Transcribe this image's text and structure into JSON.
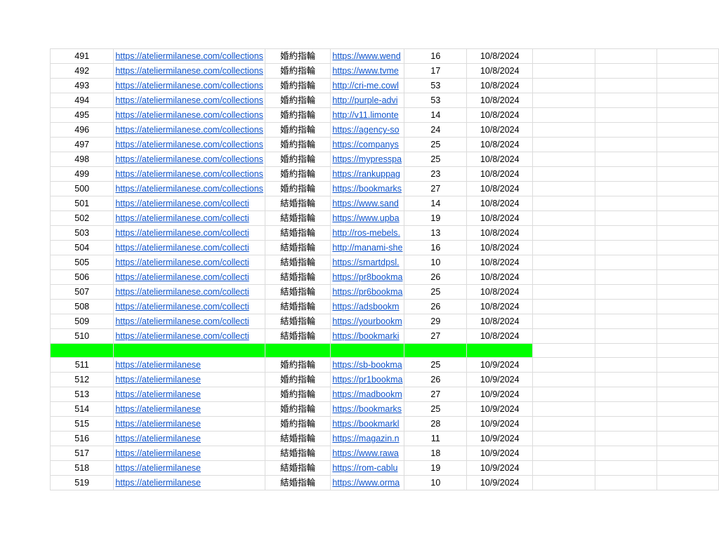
{
  "colors": {
    "separator_fill": "#00ff00",
    "link": "#1155cc",
    "grid": "#dcdcdc"
  },
  "rows": [
    {
      "num": "491",
      "url": "https://ateliermilanese.com/collections",
      "kw": "婚約指輪",
      "link": "https://www.wend",
      "count": "16",
      "date": "10/8/2024"
    },
    {
      "num": "492",
      "url": "https://ateliermilanese.com/collections",
      "kw": "婚約指輪",
      "link": "https://www.tvme",
      "count": "17",
      "date": "10/8/2024"
    },
    {
      "num": "493",
      "url": "https://ateliermilanese.com/collections",
      "kw": "婚約指輪",
      "link": "http://cri-me.cowl",
      "count": "53",
      "date": "10/8/2024"
    },
    {
      "num": "494",
      "url": "https://ateliermilanese.com/collections",
      "kw": "婚約指輪",
      "link": "http://purple-advi",
      "count": "53",
      "date": "10/8/2024"
    },
    {
      "num": "495",
      "url": "https://ateliermilanese.com/collections",
      "kw": "婚約指輪",
      "link": "http://v11.limonte",
      "count": "14",
      "date": "10/8/2024"
    },
    {
      "num": "496",
      "url": "https://ateliermilanese.com/collections",
      "kw": "婚約指輪",
      "link": "https://agency-so",
      "count": "24",
      "date": "10/8/2024"
    },
    {
      "num": "497",
      "url": "https://ateliermilanese.com/collections",
      "kw": "婚約指輪",
      "link": "https://companys",
      "count": "25",
      "date": "10/8/2024"
    },
    {
      "num": "498",
      "url": "https://ateliermilanese.com/collections",
      "kw": "婚約指輪",
      "link": "https://mypresspa",
      "count": "25",
      "date": "10/8/2024"
    },
    {
      "num": "499",
      "url": "https://ateliermilanese.com/collections",
      "kw": "婚約指輪",
      "link": "https://rankuppag",
      "count": "23",
      "date": "10/8/2024"
    },
    {
      "num": "500",
      "url": "https://ateliermilanese.com/collections",
      "kw": "婚約指輪",
      "link": "https://bookmarks",
      "count": "27",
      "date": "10/8/2024"
    },
    {
      "num": "501",
      "url": "https://ateliermilanese.com/collecti",
      "kw": "結婚指輪",
      "link": "https://www.sand",
      "count": "14",
      "date": "10/8/2024"
    },
    {
      "num": "502",
      "url": "https://ateliermilanese.com/collecti",
      "kw": "結婚指輪",
      "link": "https://www.upba",
      "count": "19",
      "date": "10/8/2024"
    },
    {
      "num": "503",
      "url": "https://ateliermilanese.com/collecti",
      "kw": "結婚指輪",
      "link": "http://ros-mebels.",
      "count": "13",
      "date": "10/8/2024"
    },
    {
      "num": "504",
      "url": "https://ateliermilanese.com/collecti",
      "kw": "結婚指輪",
      "link": "http://manami-she",
      "count": "16",
      "date": "10/8/2024"
    },
    {
      "num": "505",
      "url": "https://ateliermilanese.com/collecti",
      "kw": "結婚指輪",
      "link": "https://smartdpsl.",
      "count": "10",
      "date": "10/8/2024"
    },
    {
      "num": "506",
      "url": "https://ateliermilanese.com/collecti",
      "kw": "結婚指輪",
      "link": "https://pr8bookma",
      "count": "26",
      "date": "10/8/2024"
    },
    {
      "num": "507",
      "url": "https://ateliermilanese.com/collecti",
      "kw": "結婚指輪",
      "link": "https://pr6bookma",
      "count": "25",
      "date": "10/8/2024"
    },
    {
      "num": "508",
      "url": "https://ateliermilanese.com/collecti",
      "kw": "結婚指輪",
      "link": "https://adsbookm",
      "count": "26",
      "date": "10/8/2024"
    },
    {
      "num": "509",
      "url": "https://ateliermilanese.com/collecti",
      "kw": "結婚指輪",
      "link": "https://yourbookm",
      "count": "29",
      "date": "10/8/2024"
    },
    {
      "num": "510",
      "url": "https://ateliermilanese.com/collecti",
      "kw": "結婚指輪",
      "link": "https://bookmarki",
      "count": "27",
      "date": "10/8/2024"
    },
    {
      "separator": true
    },
    {
      "num": "511",
      "url": "https://ateliermilanese",
      "kw": "婚約指輪",
      "link": "https://sb-bookma",
      "count": "25",
      "date": "10/9/2024"
    },
    {
      "num": "512",
      "url": "https://ateliermilanese",
      "kw": "婚約指輪",
      "link": "https://pr1bookma",
      "count": "26",
      "date": "10/9/2024"
    },
    {
      "num": "513",
      "url": "https://ateliermilanese",
      "kw": "婚約指輪",
      "link": "https://madbookm",
      "count": "27",
      "date": "10/9/2024"
    },
    {
      "num": "514",
      "url": "https://ateliermilanese",
      "kw": "婚約指輪",
      "link": "https://bookmarks",
      "count": "25",
      "date": "10/9/2024"
    },
    {
      "num": "515",
      "url": "https://ateliermilanese",
      "kw": "婚約指輪",
      "link": "https://bookmarkl",
      "count": "28",
      "date": "10/9/2024"
    },
    {
      "num": "516",
      "url": "https://ateliermilanese",
      "kw": "結婚指輪",
      "link": "https://magazin.n",
      "count": "11",
      "date": "10/9/2024"
    },
    {
      "num": "517",
      "url": "https://ateliermilanese",
      "kw": "結婚指輪",
      "link": "https://www.rawa",
      "count": "18",
      "date": "10/9/2024"
    },
    {
      "num": "518",
      "url": "https://ateliermilanese",
      "kw": "結婚指輪",
      "link": "https://rom-cablu",
      "count": "19",
      "date": "10/9/2024"
    },
    {
      "num": "519",
      "url": "https://ateliermilanese",
      "kw": "結婚指輪",
      "link": "https://www.orma",
      "count": "10",
      "date": "10/9/2024"
    }
  ]
}
